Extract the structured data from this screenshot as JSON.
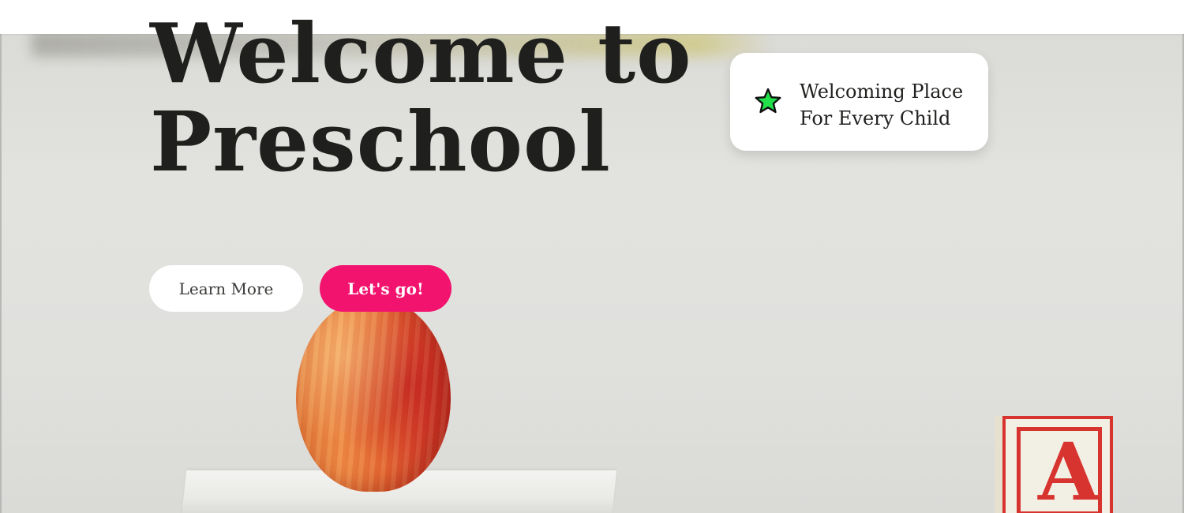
{
  "hero": {
    "headline_line1": "Welcome to",
    "headline_line2": "Preschool",
    "buttons": {
      "learn_more": "Learn More",
      "lets_go": "Let's go!"
    }
  },
  "feature_card": {
    "line1": "Welcoming Place",
    "line2": "For Every Child",
    "icon": "star-icon"
  },
  "decor": {
    "block_letter": "A"
  },
  "colors": {
    "accent": "#f2136e",
    "star": "#22e04a",
    "block_red": "#d8342f",
    "text_dark": "#1f1f1d"
  }
}
